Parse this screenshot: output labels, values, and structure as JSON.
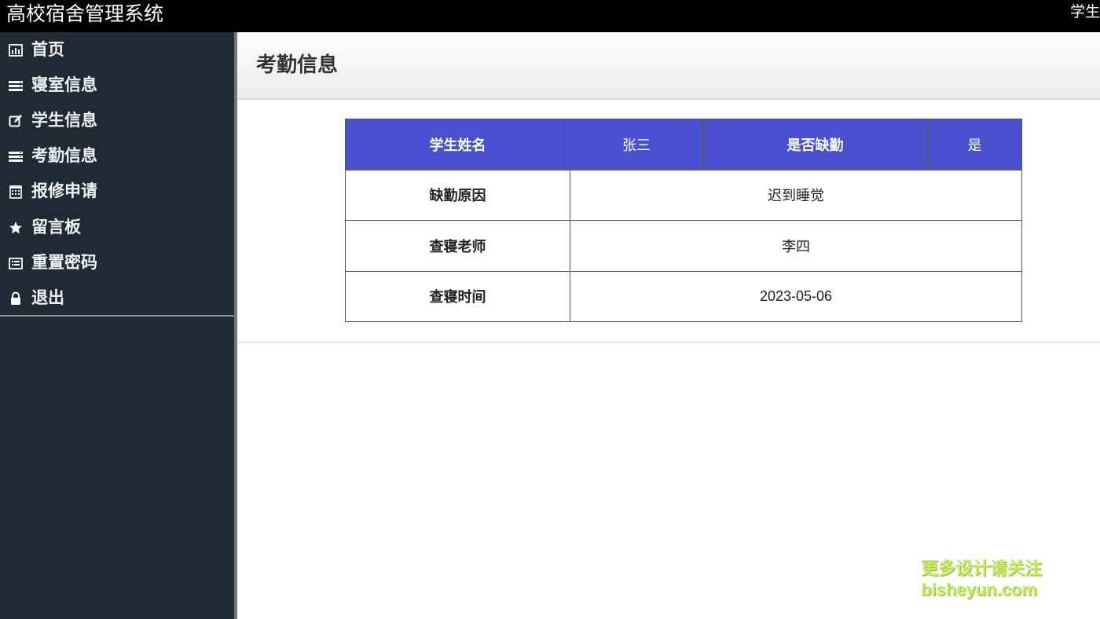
{
  "header": {
    "app_title": "高校宿舍管理系统",
    "user_label": "学生"
  },
  "sidebar": {
    "items": [
      {
        "label": "首页",
        "icon": "bar-chart-icon"
      },
      {
        "label": "寝室信息",
        "icon": "list-icon"
      },
      {
        "label": "学生信息",
        "icon": "edit-icon"
      },
      {
        "label": "考勤信息",
        "icon": "list-icon"
      },
      {
        "label": "报修申请",
        "icon": "calendar-icon"
      },
      {
        "label": "留言板",
        "icon": "star-icon"
      },
      {
        "label": "重置密码",
        "icon": "table-icon"
      },
      {
        "label": "退出",
        "icon": "lock-icon"
      }
    ]
  },
  "main": {
    "title": "考勤信息",
    "record": {
      "student_name_label": "学生姓名",
      "student_name": "张三",
      "absent_label": "是否缺勤",
      "absent": "是",
      "reason_label": "缺勤原因",
      "reason": "迟到睡觉",
      "teacher_label": "查寝老师",
      "teacher": "李四",
      "time_label": "查寝时间",
      "time": "2023-05-06"
    }
  },
  "watermark": {
    "line1": "更多设计请关注",
    "line2": "bisheyun.com"
  },
  "colors": {
    "topbar": "#000000",
    "sidebar": "#1f2a35",
    "table_header": "#4a51d1",
    "watermark": "#c8ec68"
  }
}
